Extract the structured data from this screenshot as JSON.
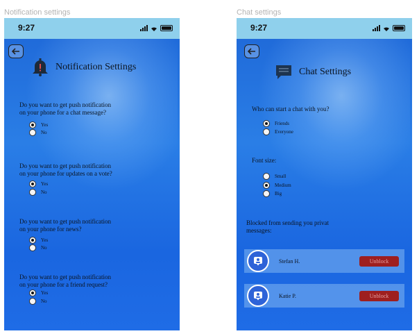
{
  "frames": {
    "notification_label": "Notification settings",
    "chat_label": "Chat settings"
  },
  "notification": {
    "status": {
      "time": "9:27"
    },
    "title": "Notification Settings",
    "questions": [
      {
        "text_line1": "Do you want to get push notification",
        "text_line2": "on your phone for a chat message?",
        "options": [
          "Yes",
          "No"
        ],
        "selected": "Yes"
      },
      {
        "text_line1": "Do you want to get push notification",
        "text_line2": "on your phone for updates on a vote?",
        "options": [
          "Yes",
          "No"
        ],
        "selected": "Yes"
      },
      {
        "text_line1": "Do you want to get push notification",
        "text_line2": "on your phone for news?",
        "options": [
          "Yes",
          "No"
        ],
        "selected": "Yes"
      },
      {
        "text_line1": "Do you want to get push notification",
        "text_line2": "on your phone for a friend request?",
        "options": [
          "Yes",
          "No"
        ],
        "selected": "Yes"
      }
    ]
  },
  "chat": {
    "status": {
      "time": "9:27"
    },
    "title": "Chat Settings",
    "who_can_start": {
      "label": "Who can start a chat with you?",
      "options": [
        "Friends",
        "Everyone"
      ],
      "selected": "Friends"
    },
    "font_size": {
      "label": "Font size:",
      "options": [
        "Small",
        "Medium",
        "Big"
      ],
      "selected": "Medium"
    },
    "blocked": {
      "label_line1": "Blocked from sending you privat",
      "label_line2": "messages:",
      "users": [
        {
          "name": "Stefan H.",
          "action": "Unblock"
        },
        {
          "name": "Katie P.",
          "action": "Unblock"
        }
      ]
    }
  },
  "colors": {
    "status_bar": "#8fd0ec",
    "unblock": "#9e1f1f",
    "avatar": "#2e63d8"
  }
}
